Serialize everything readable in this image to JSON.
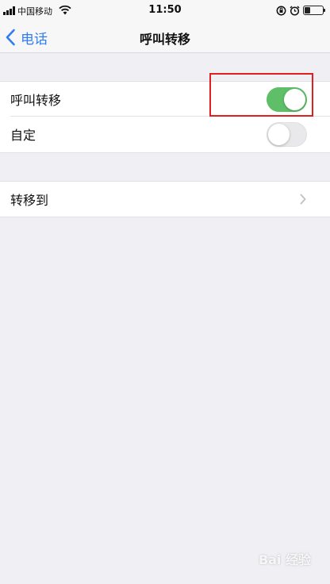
{
  "status_bar": {
    "carrier": "中国移动",
    "time": "11:50"
  },
  "nav": {
    "back_label": "电话",
    "title": "呼叫转移"
  },
  "settings": {
    "call_forwarding": {
      "label": "呼叫转移",
      "enabled": true
    },
    "custom": {
      "label": "自定",
      "enabled": false
    },
    "forward_to": {
      "label": "转移到"
    }
  },
  "colors": {
    "accent": "#2f7cf6",
    "toggle_on": "#5ebf68",
    "highlight": "#e02020"
  },
  "watermark": {
    "text": "Bai 经验"
  }
}
